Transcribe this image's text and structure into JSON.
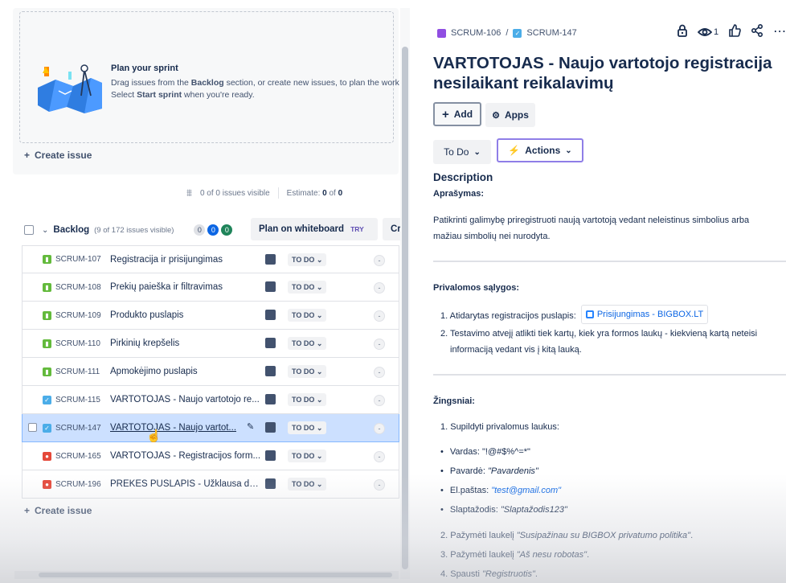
{
  "sprint": {
    "plan_title": "Plan your sprint",
    "line1_a": "Drag issues from the ",
    "line1_b": "Backlog",
    "line1_c": " section, or create new issues, to plan the work for",
    "line2_a": "Select ",
    "line2_b": "Start sprint",
    "line2_c": " when you're ready.",
    "create_issue": "Create issue",
    "issues_visible": "0 of 0 issues visible",
    "estimate_label": "Estimate:",
    "estimate_a": "0",
    "estimate_of": "of",
    "estimate_b": "0"
  },
  "backlog": {
    "title": "Backlog",
    "count": "(9 of 172 issues visible)",
    "pills": [
      "0",
      "0",
      "0"
    ],
    "plan_whiteboard": "Plan on whiteboard",
    "try": "TRY",
    "create_sprint_partial": "Cr",
    "create_issue": "Create issue",
    "rows": [
      {
        "type": "story",
        "key": "SCRUM-107",
        "summary": "Registracija ir prisijungimas",
        "status": "TO DO",
        "estimate": "-"
      },
      {
        "type": "story",
        "key": "SCRUM-108",
        "summary": "Prekių paieška ir filtravimas",
        "status": "TO DO",
        "estimate": "-"
      },
      {
        "type": "story",
        "key": "SCRUM-109",
        "summary": "Produkto puslapis",
        "status": "TO DO",
        "estimate": "-"
      },
      {
        "type": "story",
        "key": "SCRUM-110",
        "summary": "Pirkinių krepšelis",
        "status": "TO DO",
        "estimate": "-"
      },
      {
        "type": "story",
        "key": "SCRUM-111",
        "summary": "Apmokėjimo puslapis",
        "status": "TO DO",
        "estimate": "-"
      },
      {
        "type": "task",
        "key": "SCRUM-115",
        "summary": "VARTOTOJAS - Naujo vartotojo re...",
        "status": "TO DO",
        "estimate": "-"
      },
      {
        "type": "task",
        "key": "SCRUM-147",
        "summary": "VARTOTOJAS - Naujo vartot...",
        "status": "TO DO",
        "estimate": "-",
        "selected": true
      },
      {
        "type": "bug",
        "key": "SCRUM-165",
        "summary": "VARTOTOJAS - Registracijos form...",
        "status": "TO DO",
        "estimate": "-"
      },
      {
        "type": "bug",
        "key": "SCRUM-196",
        "summary": "PREKĖS PUSLAPIS - Užklausa dėl ...",
        "status": "TO DO",
        "estimate": "-"
      }
    ]
  },
  "issue": {
    "parent_key": "SCRUM-106",
    "sep": "/",
    "key": "SCRUM-147",
    "watchers": "1",
    "title": "VARTOTOJAS - Naujo vartotojo registracija nesilaikant reikalavimų",
    "add": "Add",
    "apps": "Apps",
    "status": "To Do",
    "actions": "Actions",
    "description_heading": "Description",
    "aprasymas": "Aprašymas:",
    "desc_line1": "Patikrinti galimybę priregistruoti naują vartotoją vedant neleistinus simbolius arba",
    "desc_line2": "mažiau simbolių nei nurodyta.",
    "conditions_heading": "Privalomos sąlygos:",
    "cond1": "1. Atidarytas registracijos puslapis:",
    "cond1_link": "Prisijungimas - BIGBOX.LT",
    "cond2_line1": "2. Testavimo atvejį atlikti tiek kartų, kiek yra formos laukų - kiekvieną kartą neteisi",
    "cond2_line2": "informaciją vedant vis į kitą lauką.",
    "steps_heading": "Žingsniai:",
    "step1": "1. Supildyti privalomus laukus:",
    "b1_label": "Vardas: ",
    "b1_val": "\"!@#$%^=*\"",
    "b2_label": "Pavardė: ",
    "b2_val": "\"Pavardenis\"",
    "b3_label": "El.paštas: ",
    "b3_val": "\"test@gmail.com\"",
    "b4_label": "Slaptažodis: ",
    "b4_val": "\"Slaptažodis123\"",
    "step2_a": "2. Pažymėti laukelį ",
    "step2_b": "\"Susipažinau su BIGBOX privatumo politika\"",
    "step2_c": ".",
    "step3_a": "3. Pažymėti laukelį ",
    "step3_b": "\"Aš nesu robotas\"",
    "step3_c": ".",
    "step4_a": "4. Spausti ",
    "step4_b": "\"Registruotis\"",
    "step4_c": "."
  },
  "colors": {
    "story": "#63ba3c",
    "task": "#4bade8",
    "bug": "#e5493a",
    "epic": "#904ee2",
    "selected_row": "#cce0ff"
  },
  "icons": [
    "lock-icon",
    "eye-icon",
    "thumbs-up-icon",
    "share-icon",
    "more-icon",
    "plus-icon",
    "apps-icon",
    "lightning-icon",
    "chevron-down-icon",
    "filter-icon"
  ]
}
